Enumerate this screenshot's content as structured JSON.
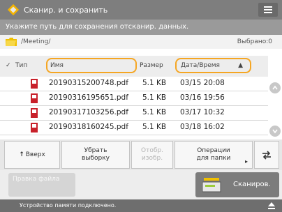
{
  "titlebar": {
    "title": "Сканир. и сохранить",
    "menu_icon": "hamburger-icon"
  },
  "instruction": "Укажите путь для сохранения отсканир. данных.",
  "path": {
    "folder_icon": "folder-icon",
    "text": "/Meeting/",
    "free_space": "Выбрано:0"
  },
  "columns": {
    "check": "✓",
    "type": "Тип",
    "name": "Имя",
    "size": "Размер",
    "date": "Дата/Время",
    "sort_indicator": "▲"
  },
  "files": [
    {
      "name": "20190315200748.pdf",
      "size": "5.1 KB",
      "date": "03/15  20:08"
    },
    {
      "name": "20190316195651.pdf",
      "size": "5.1 KB",
      "date": "03/16  19:56"
    },
    {
      "name": "20190317103256.pdf",
      "size": "5.1 KB",
      "date": "03/17  10:32"
    },
    {
      "name": "20190318160245.pdf",
      "size": "5.1 KB",
      "date": "03/18  16:02"
    }
  ],
  "toolbar": {
    "up_label": "Вверх",
    "deselect_label": "Убрать выборку",
    "display_image_label": "Отобр. изобр.",
    "folder_ops_label": "Операции для папки",
    "refresh_icon": "refresh-icon"
  },
  "bottom": {
    "edit_file_label": "Правка файла",
    "scan_label": "Сканиров."
  },
  "status": {
    "text": "Устройство памяти подключено.",
    "eject_icon": "eject-icon"
  },
  "colors": {
    "accent": "#f5a623",
    "titlebar": "#7e7e7e",
    "pdf_red": "#c8202a"
  }
}
